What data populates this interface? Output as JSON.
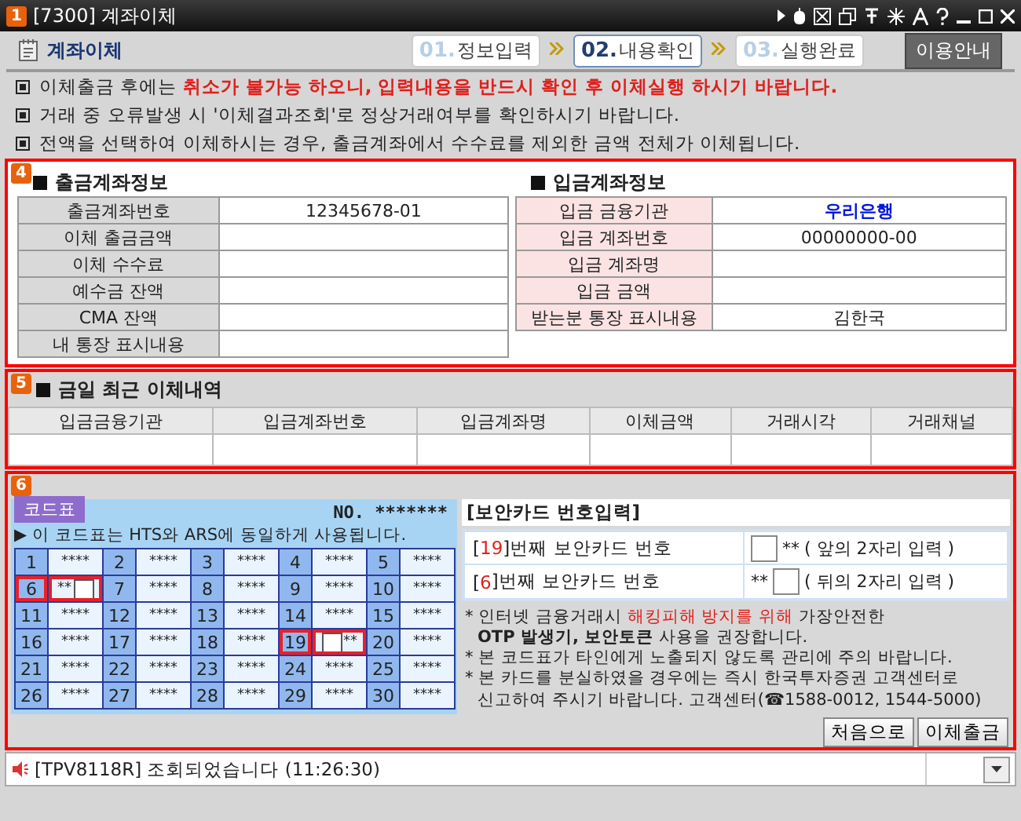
{
  "window": {
    "badge": "1",
    "title": "[7300] 계좌이체"
  },
  "header": {
    "title": "계좌이체",
    "steps": [
      {
        "number": "01.",
        "label": "정보입력",
        "selected": false
      },
      {
        "number": "02.",
        "label": "내용확인",
        "selected": true
      },
      {
        "number": "03.",
        "label": "실행완료",
        "selected": false
      }
    ],
    "help_button": "이용안내"
  },
  "notices": [
    [
      {
        "text": "이체출금 후에는 ",
        "kind": "plain"
      },
      {
        "text": "취소가 불가능 하오니, 입력내용을 반드시 확인 후 이체실행 하시기 바랍니다.",
        "kind": "warning"
      }
    ],
    [
      {
        "text": "거래 중 오류발생 시 '이체결과조회'로 정상거래여부를 확인하시기 바랍니다.",
        "kind": "plain"
      }
    ],
    [
      {
        "text": "전액을 선택하여 이체하시는 경우, 출금계좌에서 수수료를 제외한 금액 전체가 이체됩니다.",
        "kind": "plain"
      }
    ]
  ],
  "accounts": {
    "badge": "4",
    "withdrawal": {
      "title": "출금계좌정보",
      "rows": [
        {
          "label": "출금계좌번호",
          "value": "12345678-01"
        },
        {
          "label": "이체 출금금액"
        },
        {
          "label": "이체 수수료"
        },
        {
          "label": "예수금 잔액"
        },
        {
          "label": "CMA 잔액"
        },
        {
          "label": "내 통장 표시내용"
        }
      ]
    },
    "deposit": {
      "title": "입금계좌정보",
      "rows": [
        {
          "label": "입금 금융기관",
          "value": "우리은행",
          "kind": "highlight"
        },
        {
          "label": "입금 계좌번호",
          "value": "00000000-00"
        },
        {
          "label": "입금 계좌명"
        },
        {
          "label": "입금 금액"
        },
        {
          "label": "받는분 통장 표시내용",
          "value": "김한국"
        }
      ]
    }
  },
  "history": {
    "badge": "5",
    "title": "금일 최근 이체내역",
    "columns": [
      "입금금융기관",
      "입금계좌번호",
      "입금계좌명",
      "이체금액",
      "거래시각",
      "거래채널"
    ]
  },
  "security": {
    "badge": "6",
    "code_card": {
      "tab": "코드표",
      "serial_label": "NO.",
      "serial": "*******",
      "note": "▶ 이 코드표는 HTS와 ARS에 동일하게 사용됩니다.",
      "cells": [
        {
          "number": "1",
          "kind": "masked",
          "code": "****"
        },
        {
          "number": "2",
          "kind": "masked",
          "code": "****"
        },
        {
          "number": "3",
          "kind": "masked",
          "code": "****"
        },
        {
          "number": "4",
          "kind": "masked",
          "code": "****"
        },
        {
          "number": "5",
          "kind": "masked",
          "code": "****"
        },
        {
          "number": "6",
          "kind": "input-after",
          "code": "**"
        },
        {
          "number": "7",
          "kind": "masked",
          "code": "****"
        },
        {
          "number": "8",
          "kind": "masked",
          "code": "****"
        },
        {
          "number": "9",
          "kind": "masked",
          "code": "****"
        },
        {
          "number": "10",
          "kind": "masked",
          "code": "****"
        },
        {
          "number": "11",
          "kind": "masked",
          "code": "****"
        },
        {
          "number": "12",
          "kind": "masked",
          "code": "****"
        },
        {
          "number": "13",
          "kind": "masked",
          "code": "****"
        },
        {
          "number": "14",
          "kind": "masked",
          "code": "****"
        },
        {
          "number": "15",
          "kind": "masked",
          "code": "****"
        },
        {
          "number": "16",
          "kind": "masked",
          "code": "****"
        },
        {
          "number": "17",
          "kind": "masked",
          "code": "****"
        },
        {
          "number": "18",
          "kind": "masked",
          "code": "****"
        },
        {
          "number": "19",
          "kind": "input-before",
          "code": "**"
        },
        {
          "number": "20",
          "kind": "masked",
          "code": "****"
        },
        {
          "number": "21",
          "kind": "masked",
          "code": "****"
        },
        {
          "number": "22",
          "kind": "masked",
          "code": "****"
        },
        {
          "number": "23",
          "kind": "masked",
          "code": "****"
        },
        {
          "number": "24",
          "kind": "masked",
          "code": "****"
        },
        {
          "number": "25",
          "kind": "masked",
          "code": "****"
        },
        {
          "number": "26",
          "kind": "masked",
          "code": "****"
        },
        {
          "number": "27",
          "kind": "masked",
          "code": "****"
        },
        {
          "number": "28",
          "kind": "masked",
          "code": "****"
        },
        {
          "number": "29",
          "kind": "masked",
          "code": "****"
        },
        {
          "number": "30",
          "kind": "masked",
          "code": "****"
        }
      ]
    },
    "entry_title": "[보안카드 번호입력]",
    "entries": [
      {
        "open": "[",
        "number": "19",
        "close": "]번째 보안카드 번호",
        "kind": "input-before",
        "mask": "**",
        "hint": "( 앞의 2자리 입력 )"
      },
      {
        "open": "[",
        "number": "6",
        "close": "]번째 보안카드 번호",
        "kind": "input-after",
        "mask": "**",
        "hint": "( 뒤의 2자리 입력 )"
      }
    ],
    "notes": [
      [
        [
          {
            "text": "* 인터넷 금융거래시 ",
            "kind": "plain"
          },
          {
            "text": "해킹피해 방지를 위해",
            "kind": "highlight"
          },
          {
            "text": " 가장안전한",
            "kind": "plain"
          }
        ],
        [
          {
            "text": "OTP 발생기, 보안토큰",
            "kind": "strong"
          },
          {
            "text": " 사용을 권장합니다.",
            "kind": "plain"
          }
        ]
      ],
      [
        [
          {
            "text": "* 본 코드표가 타인에게 노출되지 않도록 관리에 주의 바랍니다.",
            "kind": "plain"
          }
        ]
      ],
      [
        [
          {
            "text": "* 본 카드를 분실하였을 경우에는 즉시 한국투자증권 고객센터로",
            "kind": "plain"
          }
        ],
        [
          {
            "text": "신고하여 주시기 바랍니다. 고객센터(☎1588-0012, 1544-5000)",
            "kind": "plain"
          }
        ]
      ]
    ]
  },
  "buttons": [
    "처음으로",
    "이체출금"
  ],
  "status_bar": {
    "message": "[TPV8118R] 조회되었습니다 (11:26:30)"
  }
}
